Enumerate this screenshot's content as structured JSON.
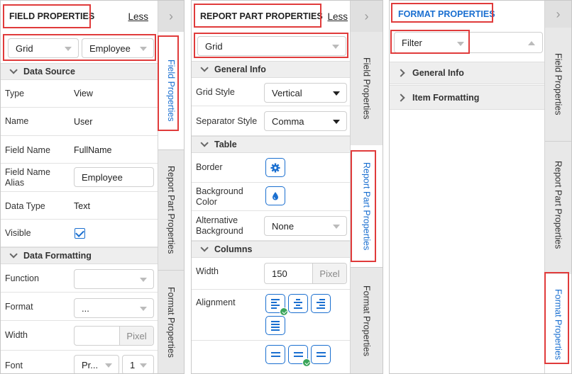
{
  "field_panel": {
    "title": "FIELD PROPERTIES",
    "less": "Less",
    "selector_grid": "Grid",
    "selector_field": "Employee",
    "data_source": {
      "header": "Data Source",
      "type_label": "Type",
      "type_value": "View",
      "name_label": "Name",
      "name_value": "User",
      "field_name_label": "Field Name",
      "field_name_value": "FullName",
      "alias_label_1": "Field Name",
      "alias_label_2": "Alias",
      "alias_value": "Employee",
      "data_type_label": "Data Type",
      "data_type_value": "Text",
      "visible_label": "Visible"
    },
    "data_formatting": {
      "header": "Data Formatting",
      "function_label": "Function",
      "function_value": "",
      "format_label": "Format",
      "format_value": "...",
      "width_label": "Width",
      "width_unit": "Pixel",
      "font_label": "Font",
      "font_value": "Pr...",
      "font_size": "1"
    },
    "tabs": [
      "Field Properties",
      "Report Part Properties",
      "Format Properties"
    ]
  },
  "report_panel": {
    "title": "REPORT PART PROPERTIES",
    "less": "Less",
    "selector": "Grid",
    "general": {
      "header": "General Info",
      "grid_style_label": "Grid Style",
      "grid_style_value": "Vertical",
      "separator_label": "Separator Style",
      "separator_value": "Comma"
    },
    "table": {
      "header": "Table",
      "border_label": "Border",
      "bg_label_1": "Background",
      "bg_label_2": "Color",
      "alt_label_1": "Alternative",
      "alt_label_2": "Background",
      "alt_value": "None"
    },
    "columns": {
      "header": "Columns",
      "width_label": "Width",
      "width_value": "150",
      "width_unit": "Pixel",
      "alignment_label": "Alignment"
    },
    "tabs": [
      "Field Properties",
      "Report Part Properties",
      "Format Properties"
    ]
  },
  "format_panel": {
    "title": "FORMAT PROPERTIES",
    "selector": "Filter",
    "sections": [
      "General Info",
      "Item Formatting"
    ],
    "tabs": [
      "Field Properties",
      "Report Part Properties",
      "Format Properties"
    ]
  },
  "colors": {
    "accent": "#1a6fd0",
    "highlight": "#e03b3b",
    "check_badge": "#3aa55a"
  }
}
